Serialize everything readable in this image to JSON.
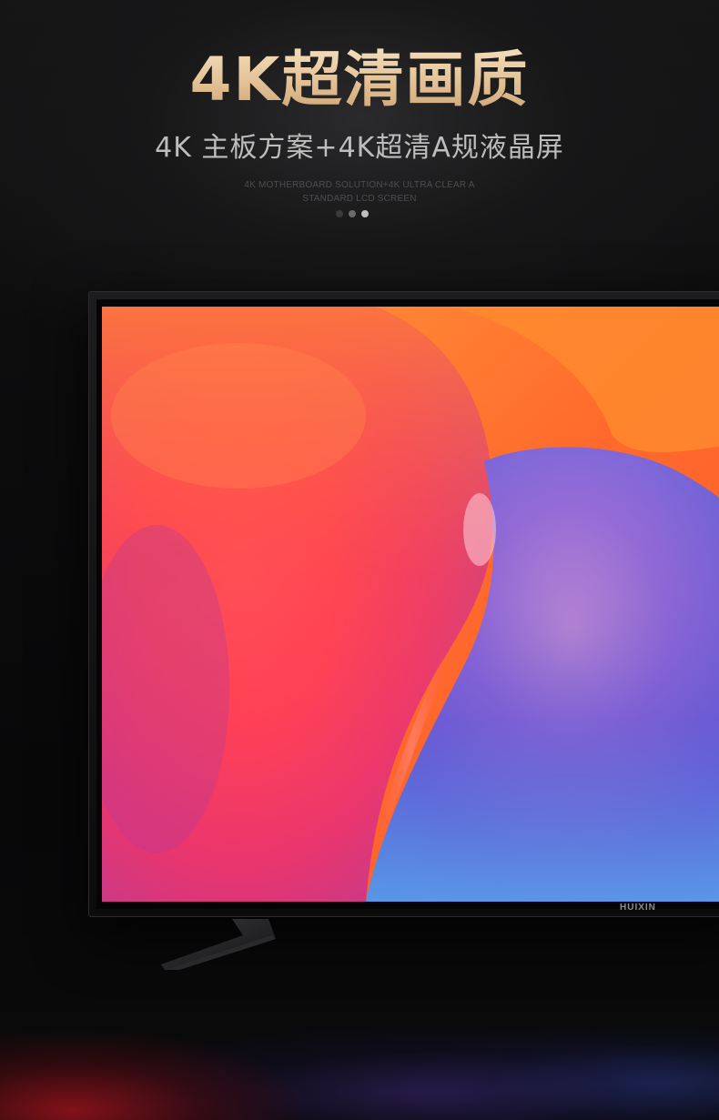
{
  "hero": {
    "title": "4K超清画质",
    "subtitle": "4K 主板方案+4K超清A规液晶屏",
    "caption_line1": "4K MOTHERBOARD SOLUTION+4K ULTRA CLEAR A",
    "caption_line2": "STANDARD LCD SCREEN"
  },
  "carousel": {
    "dot_count": 3,
    "active_index": 2
  },
  "tv": {
    "brand": "HUIXIN"
  },
  "colors": {
    "title_gold": "#e9cfa6",
    "subtitle_gray": "#bdbdbd",
    "background": "#0b0b0c",
    "screen_orange": "#ff6a33",
    "screen_pink": "#ff3e6c",
    "screen_purple": "#7a5ad8",
    "screen_blue": "#4a7ee0"
  }
}
